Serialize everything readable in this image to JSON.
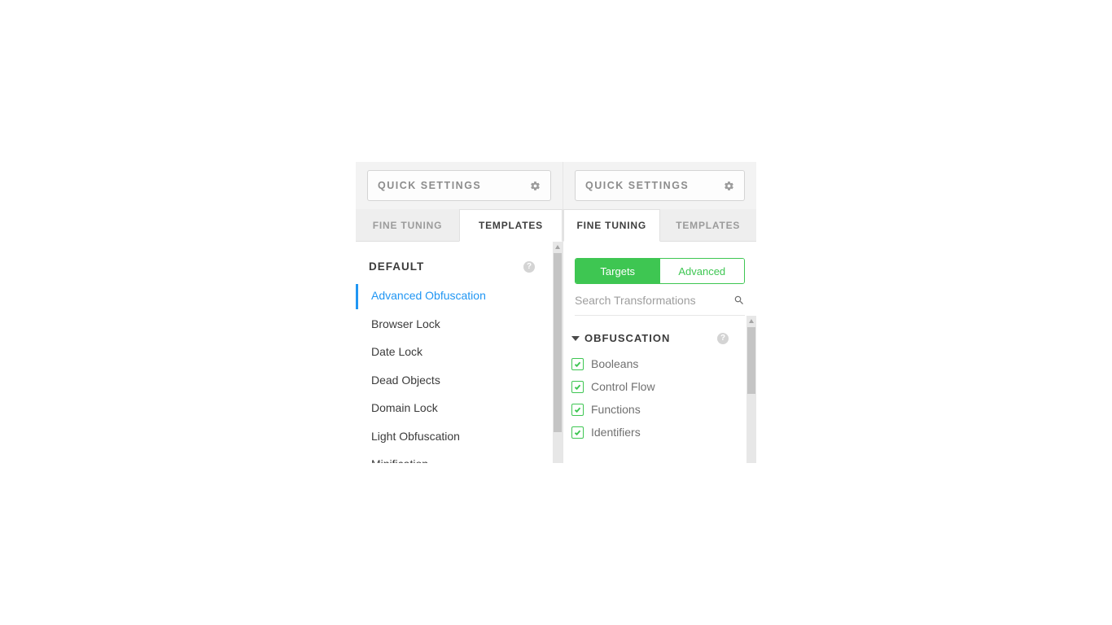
{
  "left": {
    "quick_settings_label": "QUICK SETTINGS",
    "tabs": {
      "fine_tuning": "FINE TUNING",
      "templates": "TEMPLATES"
    },
    "section_title": "DEFAULT",
    "templates": [
      "Advanced Obfuscation",
      "Browser Lock",
      "Date Lock",
      "Dead Objects",
      "Domain Lock",
      "Light Obfuscation",
      "Minification"
    ]
  },
  "right": {
    "quick_settings_label": "QUICK SETTINGS",
    "tabs": {
      "fine_tuning": "FINE TUNING",
      "templates": "TEMPLATES"
    },
    "segments": {
      "targets": "Targets",
      "advanced": "Advanced"
    },
    "search_placeholder": "Search Transformations",
    "group_title": "OBFUSCATION",
    "transformations": [
      "Booleans",
      "Control Flow",
      "Functions",
      "Identifiers"
    ]
  },
  "icons": {
    "gear": "gear-icon",
    "help": "help-icon",
    "search": "search-icon",
    "caret": "caret-down-icon",
    "check": "check-icon"
  },
  "colors": {
    "accent_blue": "#2096f3",
    "accent_green": "#3ec652",
    "panel_bg": "#f3f3f3"
  }
}
